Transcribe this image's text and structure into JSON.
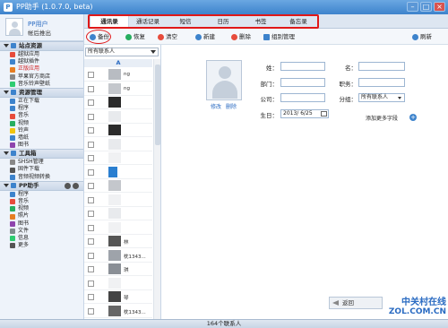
{
  "window": {
    "title": "PP助手 (1.0.7.0, beta)",
    "controls": [
      "minimize",
      "maximize",
      "close"
    ]
  },
  "user": {
    "name": "PP用户",
    "logout": "帐后推出"
  },
  "sidebar": {
    "sections": [
      {
        "label": "站点资源",
        "items": [
          {
            "label": "越狱应用",
            "active": false,
            "color": "#e74c3c"
          },
          {
            "label": "越狱插件",
            "active": false,
            "color": "#3d83cc"
          },
          {
            "label": "正版应用",
            "active": true,
            "color": "#e67e22"
          },
          {
            "label": "苹果官方商店",
            "active": false,
            "color": "#888888"
          },
          {
            "label": "音乐铃声壁纸",
            "active": false,
            "color": "#2ecc71"
          }
        ]
      },
      {
        "label": "资源管理",
        "items": [
          {
            "label": "正在下载",
            "color": "#3d83cc"
          },
          {
            "label": "程序",
            "color": "#3d83cc"
          },
          {
            "label": "音乐",
            "color": "#e74c3c"
          },
          {
            "label": "视频",
            "color": "#27ae60"
          },
          {
            "label": "铃声",
            "color": "#f1c40f"
          },
          {
            "label": "墙纸",
            "color": "#3d83cc"
          },
          {
            "label": "图书",
            "color": "#8e44ad"
          }
        ]
      },
      {
        "label": "工具箱",
        "items": [
          {
            "label": "SHSH管理",
            "color": "#888888"
          },
          {
            "label": "固件下载",
            "color": "#555555"
          },
          {
            "label": "音频视频转换",
            "color": "#3d83cc"
          }
        ]
      },
      {
        "label": "PP助手",
        "items": [
          {
            "label": "程序",
            "color": "#3d83cc"
          },
          {
            "label": "音乐",
            "color": "#e74c3c"
          },
          {
            "label": "视频",
            "color": "#27ae60"
          },
          {
            "label": "照片",
            "color": "#e67e22"
          },
          {
            "label": "图书",
            "color": "#8e44ad"
          },
          {
            "label": "文件",
            "color": "#7f8c8d"
          },
          {
            "label": "信息",
            "color": "#2ecc71"
          },
          {
            "label": "更多",
            "color": "#555555"
          }
        ]
      }
    ]
  },
  "tabs": [
    "通讯录",
    "通话记录",
    "短信",
    "日历",
    "书签",
    "备忘录"
  ],
  "active_tab": 0,
  "toolbar": {
    "backup": "备份",
    "restore": "恢复",
    "clear": "清空",
    "new": "新建",
    "delete": "删除",
    "group": "组别管理",
    "refresh": "刷新"
  },
  "contacts": {
    "filter": "所有联系人",
    "letter": "A",
    "rows": [
      {
        "text": "ng"
      },
      {
        "text": "ng"
      },
      {
        "text": ""
      },
      {
        "text": ""
      },
      {
        "text": ""
      },
      {
        "text": ""
      },
      {
        "text": ""
      },
      {
        "text": ""
      },
      {
        "text": ""
      },
      {
        "text": ""
      },
      {
        "text": ""
      },
      {
        "text": ""
      },
      {
        "text": "林"
      },
      {
        "text": "枕1343..."
      },
      {
        "text": "琪"
      },
      {
        "text": ""
      },
      {
        "text": "琴"
      },
      {
        "text": "枕1343..."
      }
    ]
  },
  "detail": {
    "edit": "修改",
    "delete": "删除",
    "labels": {
      "surname": "姓：",
      "given": "名：",
      "dept": "部门：",
      "title": "职务：",
      "company": "公司：",
      "group": "分组：",
      "birthday": "生日："
    },
    "group_value": "所有联系人",
    "birthday_value": "2013/ 6/25",
    "add_more": "添加更多字段",
    "return": "返回"
  },
  "watermark": {
    "line1": "中关村在线",
    "line2": "ZOL.COM.CN"
  },
  "status": "164个联系人"
}
